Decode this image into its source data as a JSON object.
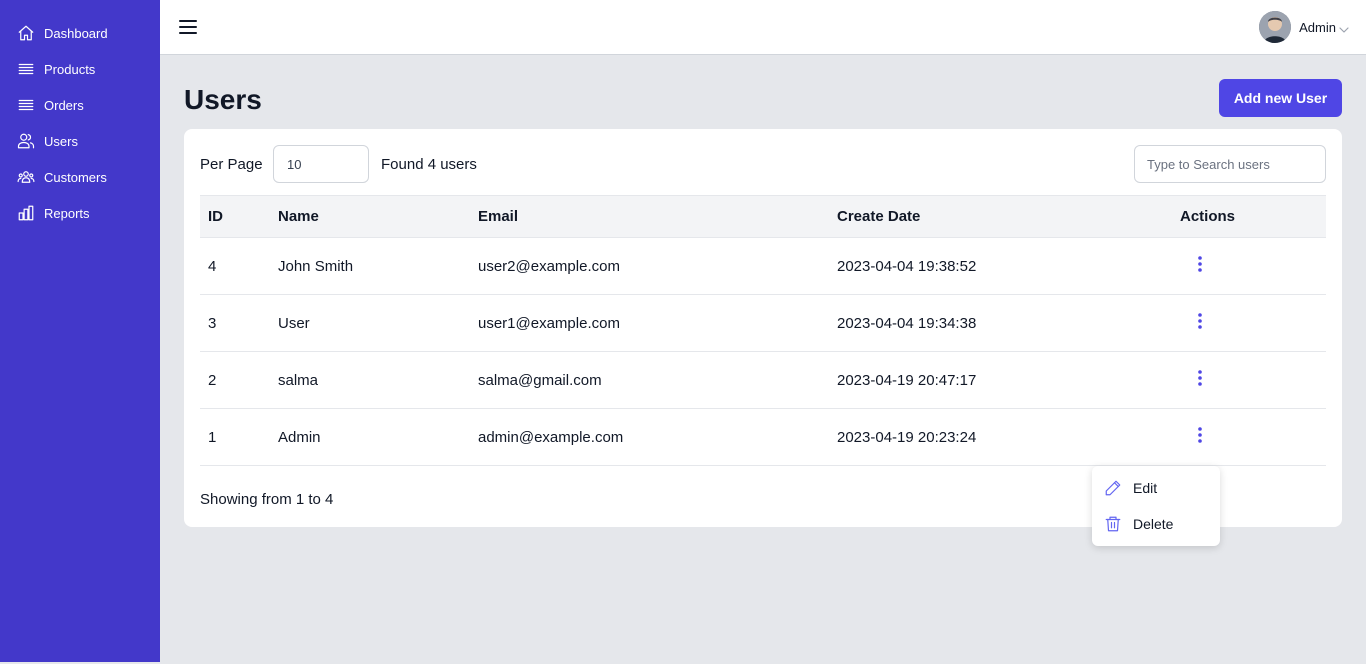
{
  "sidebar": {
    "items": [
      {
        "label": "Dashboard",
        "icon": "home-icon"
      },
      {
        "label": "Products",
        "icon": "list-icon"
      },
      {
        "label": "Orders",
        "icon": "list-icon"
      },
      {
        "label": "Users",
        "icon": "users-icon"
      },
      {
        "label": "Customers",
        "icon": "user-group-icon"
      },
      {
        "label": "Reports",
        "icon": "bar-chart-icon"
      }
    ]
  },
  "header": {
    "user_name": "Admin"
  },
  "page": {
    "title": "Users",
    "add_button_label": "Add new User"
  },
  "controls": {
    "per_page_label": "Per Page",
    "per_page_value": "10",
    "found_text": "Found 4 users",
    "search_placeholder": "Type to Search users"
  },
  "table": {
    "columns": [
      "ID",
      "Name",
      "Email",
      "Create Date",
      "Actions"
    ],
    "rows": [
      {
        "id": "4",
        "name": "John Smith",
        "email": "user2@example.com",
        "created": "2023-04-04 19:38:52"
      },
      {
        "id": "3",
        "name": "User",
        "email": "user1@example.com",
        "created": "2023-04-04 19:34:38"
      },
      {
        "id": "2",
        "name": "salma",
        "email": "salma@gmail.com",
        "created": "2023-04-19 20:47:17"
      },
      {
        "id": "1",
        "name": "Admin",
        "email": "admin@example.com",
        "created": "2023-04-19 20:23:24"
      }
    ]
  },
  "footer": {
    "showing_text": "Showing from 1 to 4"
  },
  "dropdown": {
    "edit_label": "Edit",
    "delete_label": "Delete"
  },
  "colors": {
    "sidebar_bg": "#4338ca",
    "accent": "#4f46e5",
    "page_bg": "#e5e7eb"
  }
}
